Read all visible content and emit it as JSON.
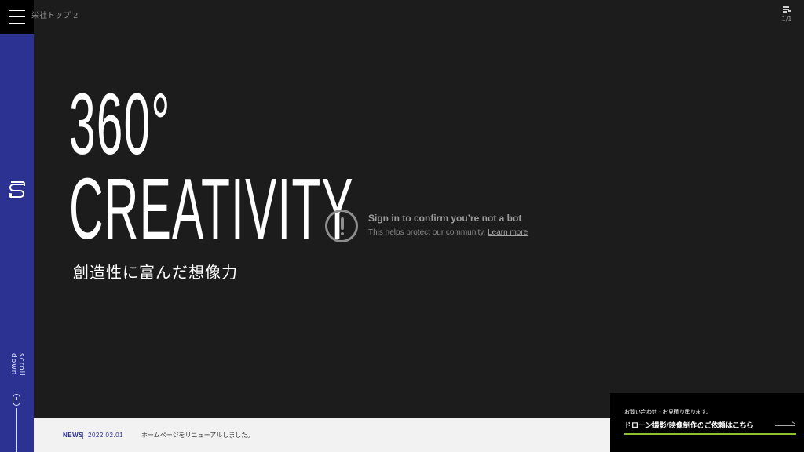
{
  "header": {
    "video_title": "栄社トップ 2",
    "playlist_count": "1/1"
  },
  "sidebar": {
    "scroll_label": "scroll down"
  },
  "hero": {
    "line1": "360°",
    "line2": "CREATIVITY",
    "subtitle": "創造性に富んだ想像力"
  },
  "bot_check": {
    "title": "Sign in to confirm you’re not a bot",
    "subtitle": "This helps protect our community.",
    "link": "Learn more"
  },
  "news": {
    "label": "NEWS",
    "separator": "|",
    "date": "2022.02.01",
    "text": "ホームページをリニューアルしました。"
  },
  "contact": {
    "small": "お問い合わせ・お見積り承ります。",
    "main": "ドローン撮影/映像制作のご依頼はこちら",
    "accent_color": "#8ebf2c"
  },
  "colors": {
    "sidebar": "#2b3291",
    "background": "#1c1c1d"
  },
  "icons": [
    "menu-icon",
    "logo-icon",
    "playlist-icon",
    "alert-icon",
    "mouse-icon",
    "arrow-right-icon"
  ]
}
